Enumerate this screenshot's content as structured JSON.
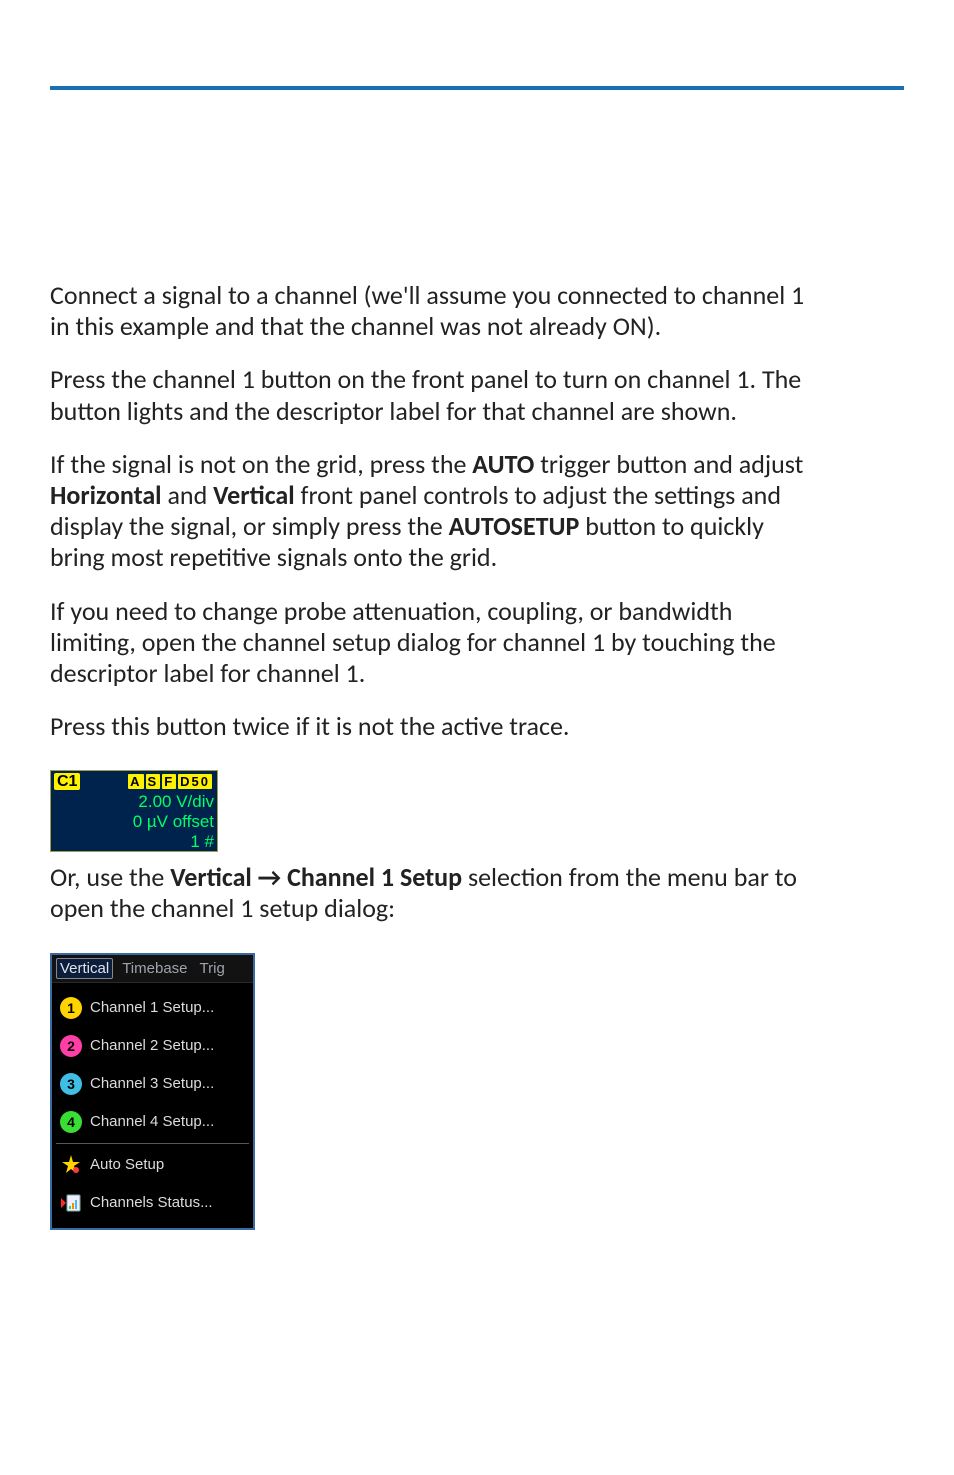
{
  "paragraphs": {
    "p1": "Connect a signal to a channel (we'll assume you connected to channel 1 in this example and that the channel was not already ON).",
    "p2": "Press the channel 1 button on the front panel to turn on channel 1. The button lights and the descriptor label for that channel are shown.",
    "p3_a": "If the signal is not on the grid, press the ",
    "p3_b": "AUTO",
    "p3_c": " trigger button and adjust ",
    "p3_d": "Horizontal",
    "p3_e": " and ",
    "p3_f": "Vertical",
    "p3_g": " front panel controls to adjust the settings and display the signal, or simply press the ",
    "p3_h": "AUTOSETUP",
    "p3_i": " button to quickly bring most repetitive signals onto the grid.",
    "p4": "If you need to change probe attenuation, coupling, or bandwidth limiting, open the channel setup dialog for channel 1 by touching the descriptor label for channel 1.",
    "p5": "Press this button twice if it is not the active trace.",
    "p6_a": "Or, use the ",
    "p6_b": "Vertical",
    "p6_arrow": " → ",
    "p6_c": "Channel 1 Setup",
    "p6_d": " selection from the menu bar to open the channel 1 setup dialog:"
  },
  "descriptor": {
    "channel": "C1",
    "badges": {
      "a": "A",
      "s": "S",
      "f": "F",
      "d": "D50"
    },
    "vdiv": "2.00 V/div",
    "offset": "0 µV offset",
    "hash": "1 #"
  },
  "menu": {
    "tabs": {
      "vertical": "Vertical",
      "timebase": "Timebase",
      "trig": "Trig"
    },
    "items": {
      "ch1": "Channel 1 Setup...",
      "ch2": "Channel 2 Setup...",
      "ch3": "Channel 3 Setup...",
      "ch4": "Channel 4 Setup...",
      "auto": "Auto Setup",
      "status": "Channels Status..."
    }
  }
}
